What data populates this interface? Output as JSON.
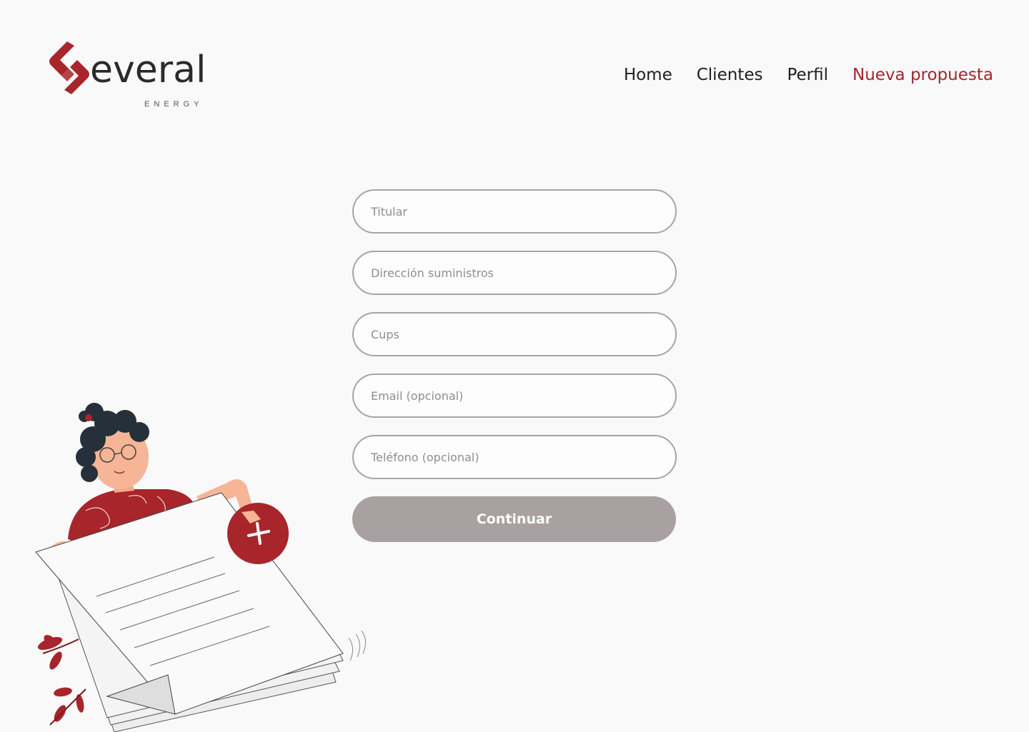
{
  "brand": {
    "name": "everal",
    "tagline": "ENERGY",
    "color": "#a8252b"
  },
  "nav": {
    "items": [
      {
        "label": "Home",
        "active": false
      },
      {
        "label": "Clientes",
        "active": false
      },
      {
        "label": "Perfil",
        "active": false
      },
      {
        "label": "Nueva propuesta",
        "active": true
      }
    ]
  },
  "form": {
    "titular_placeholder": "Titular",
    "direccion_placeholder": "Dirección suministros",
    "cups_placeholder": "Cups",
    "email_placeholder": "Email (opcional)",
    "telefono_placeholder": "Teléfono (opcional)",
    "submit_label": "Continuar"
  },
  "colors": {
    "accent": "#a8252b",
    "button_disabled": "#a8a0a1",
    "background": "#f9f9f9"
  }
}
